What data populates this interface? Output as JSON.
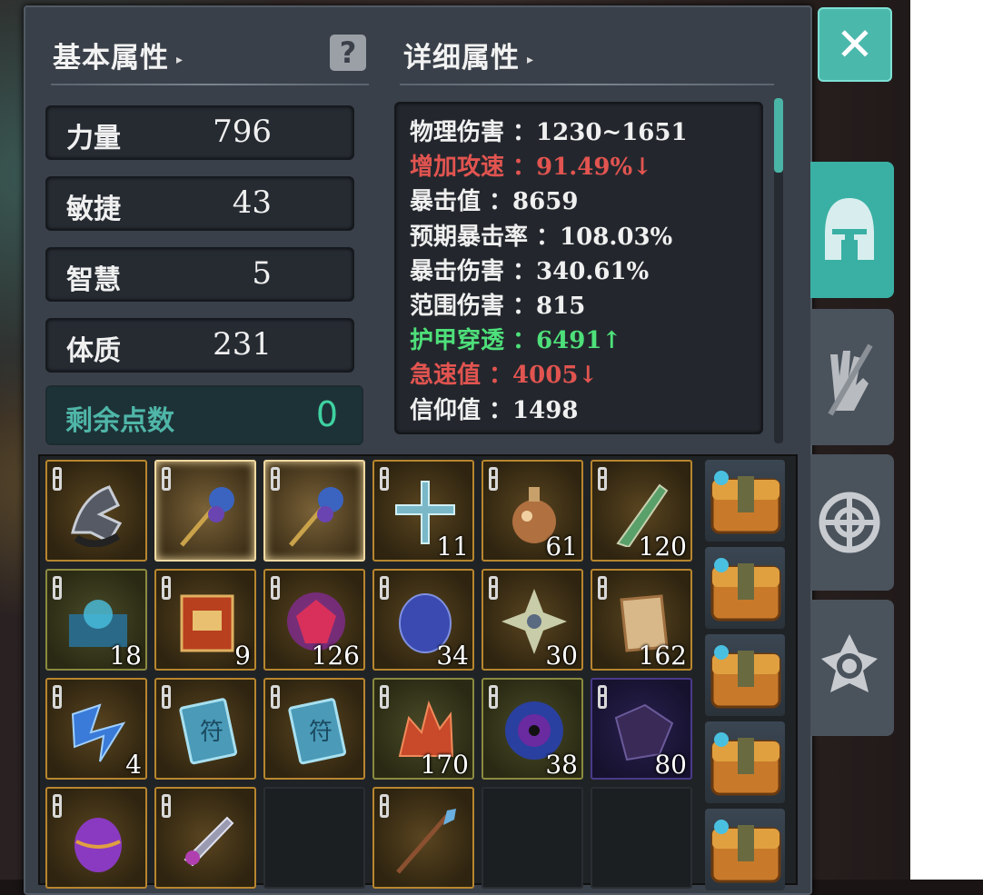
{
  "basic_attributes": {
    "title": "基本属性",
    "stats": [
      {
        "name": "力量",
        "value": "796"
      },
      {
        "name": "敏捷",
        "value": "43"
      },
      {
        "name": "智慧",
        "value": "5"
      },
      {
        "name": "体质",
        "value": "231"
      }
    ],
    "remaining": {
      "name": "剩余点数",
      "value": "0"
    }
  },
  "detail_attributes": {
    "title": "详细属性",
    "rows": [
      {
        "text": "物理伤害 ：1230~1651",
        "color": "#f0f0f0"
      },
      {
        "text": "增加攻速 ：91.49%↓",
        "color": "#e25450"
      },
      {
        "text": "暴击值 ：8659",
        "color": "#f0f0f0"
      },
      {
        "text": "预期暴击率 ：108.03%",
        "color": "#f0f0f0"
      },
      {
        "text": "暴击伤害 ：340.61%",
        "color": "#f0f0f0"
      },
      {
        "text": "范围伤害 ：815",
        "color": "#f0f0f0"
      },
      {
        "text": "护甲穿透 ：6491↑",
        "color": "#4ee07a"
      },
      {
        "text": "急速值 ：4005↓",
        "color": "#e25450"
      },
      {
        "text": "信仰值 ：1498",
        "color": "#f0f0f0"
      }
    ]
  },
  "inventory": {
    "slots": [
      {
        "icon": "claw-weapon-icon",
        "count": "",
        "style": "normal"
      },
      {
        "icon": "staff-icon",
        "count": "",
        "style": "sel"
      },
      {
        "icon": "staff-icon",
        "count": "",
        "style": "sel"
      },
      {
        "icon": "cross-icon",
        "count": "11",
        "style": "normal"
      },
      {
        "icon": "potion-icon",
        "count": "61",
        "style": "normal"
      },
      {
        "icon": "dagger-icon",
        "count": "120",
        "style": "normal"
      },
      {
        "icon": "blue-scroll-icon",
        "count": "18",
        "style": "green"
      },
      {
        "icon": "red-scroll-icon",
        "count": "9",
        "style": "normal"
      },
      {
        "icon": "ruby-gem-icon",
        "count": "126",
        "style": "normal"
      },
      {
        "icon": "heart-stone-icon",
        "count": "34",
        "style": "normal"
      },
      {
        "icon": "snowflake-crystal-icon",
        "count": "30",
        "style": "normal"
      },
      {
        "icon": "parchment-icon",
        "count": "162",
        "style": "normal"
      },
      {
        "icon": "blue-shard-icon",
        "count": "4",
        "style": "normal"
      },
      {
        "icon": "rune-card-icon",
        "count": "",
        "style": "normal"
      },
      {
        "icon": "rune-card-icon",
        "count": "",
        "style": "normal"
      },
      {
        "icon": "red-crystal-icon",
        "count": "170",
        "style": "green"
      },
      {
        "icon": "vortex-orb-icon",
        "count": "38",
        "style": "green"
      },
      {
        "icon": "dark-fragment-icon",
        "count": "80",
        "style": "purple"
      },
      {
        "icon": "purple-egg-icon",
        "count": "",
        "style": "normal"
      },
      {
        "icon": "chained-blade-icon",
        "count": "",
        "style": "normal"
      },
      {
        "icon": "",
        "count": "",
        "style": "empty"
      },
      {
        "icon": "spear-icon",
        "count": "",
        "style": "normal"
      },
      {
        "icon": "",
        "count": "",
        "style": "empty"
      },
      {
        "icon": "",
        "count": "",
        "style": "empty"
      }
    ],
    "bags": [
      "bag-icon",
      "bag-icon",
      "bag-icon",
      "bag-icon",
      "bag-icon"
    ]
  },
  "side_tabs": [
    "helmet-icon",
    "gloves-icon",
    "target-icon",
    "gear-settings-icon"
  ],
  "colors": {
    "accent": "#4bb8ac",
    "panel": "#3a4049"
  }
}
